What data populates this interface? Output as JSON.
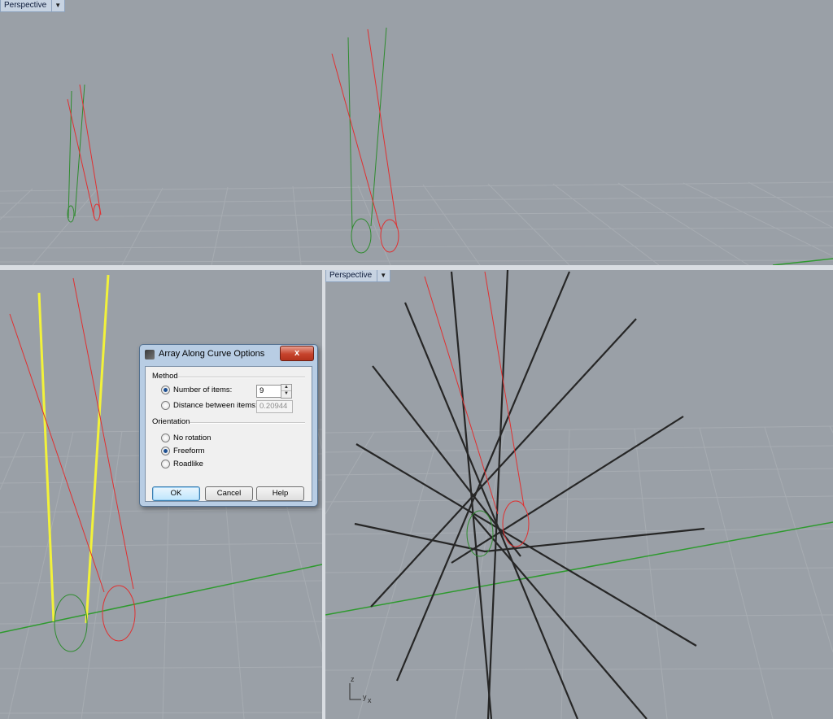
{
  "viewports": {
    "top": {
      "label": "Perspective"
    },
    "bottom_right": {
      "label": "Perspective"
    }
  },
  "axis_indicator": {
    "z": "z",
    "y": "y",
    "x": "x"
  },
  "dialog": {
    "title": "Array Along Curve Options",
    "close_label": "x",
    "method": {
      "heading": "Method",
      "number_of_items_label": "Number of items:",
      "number_of_items_value": "9",
      "distance_label": "Distance between items:",
      "distance_value": "0.20944",
      "selected": "number_of_items"
    },
    "orientation": {
      "heading": "Orientation",
      "options": [
        "No rotation",
        "Freeform",
        "Roadlike"
      ],
      "selected": "Freeform"
    },
    "buttons": {
      "ok": "OK",
      "cancel": "Cancel",
      "help": "Help"
    }
  },
  "colors": {
    "viewport_bg": "#9aa0a7",
    "grid_line": "#a9aeb4",
    "red_curve": "#e03030",
    "green_curve": "#2e8b2e",
    "selected_curve": "#f2f23a",
    "array_curve": "#2b2b2b",
    "accent_title": "#b8cde4",
    "close_button": "#c6432c"
  },
  "icons": {
    "viewport_menu": "caret-down-icon",
    "dialog_icon": "rhino-icon",
    "close": "close-icon"
  }
}
